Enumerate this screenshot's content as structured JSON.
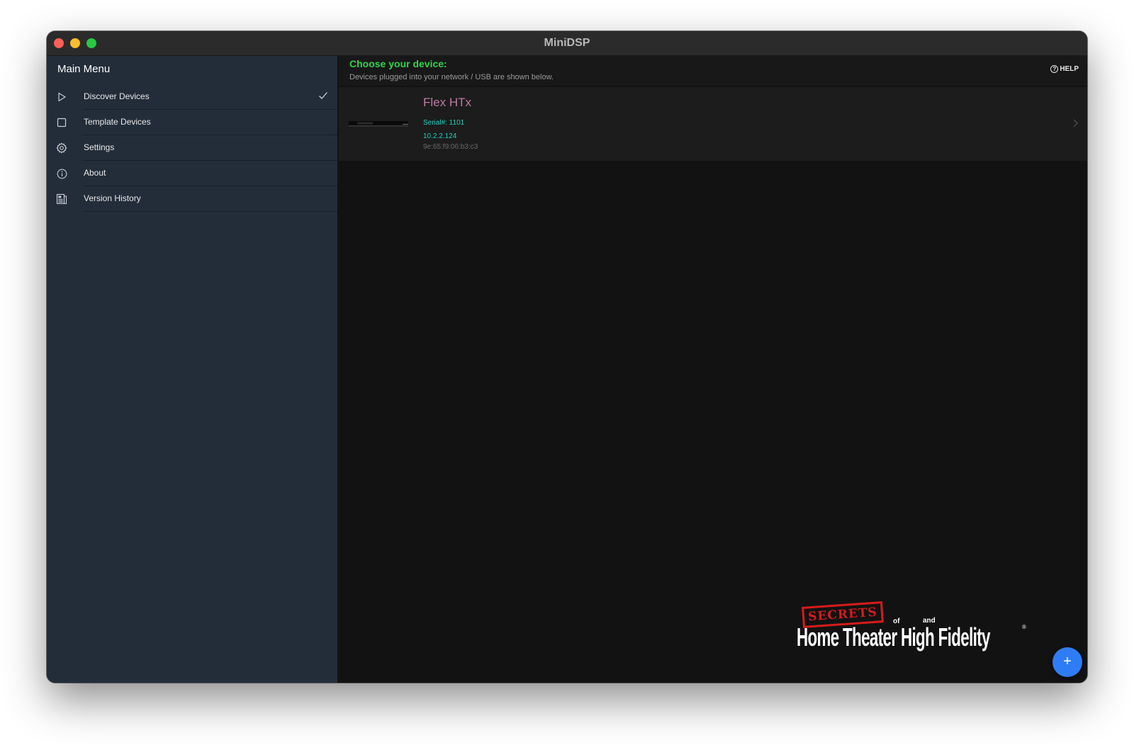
{
  "window": {
    "title": "MiniDSP"
  },
  "sidebar": {
    "title": "Main Menu",
    "items": [
      {
        "label": "Discover Devices",
        "icon": "play-icon",
        "selected": true
      },
      {
        "label": "Template Devices",
        "icon": "square-icon",
        "selected": false
      },
      {
        "label": "Settings",
        "icon": "gear-icon",
        "selected": false
      },
      {
        "label": "About",
        "icon": "info-icon",
        "selected": false
      },
      {
        "label": "Version History",
        "icon": "document-icon",
        "selected": false
      }
    ]
  },
  "main": {
    "title": "Choose your device:",
    "subtitle": "Devices plugged into your network / USB are shown below.",
    "help_label": "HELP",
    "help_glyph": "?",
    "devices": [
      {
        "name": "Flex HTx",
        "serial": "Serial#: 1101",
        "ip": "10.2.2.124",
        "mac": "9e:65:f9:06:b3:c3"
      }
    ],
    "fab_label": "+"
  },
  "watermark": {
    "stamp": "SECRETS",
    "of": "of",
    "and": "and",
    "text": "Home Theater High Fidelity",
    "reg": "®"
  },
  "colors": {
    "accent_green": "#2fd34a",
    "device_name": "#c07aa6",
    "device_detail": "#1fd1c1",
    "sidebar_bg": "#232d3a",
    "fab_blue": "#2f7df6"
  }
}
